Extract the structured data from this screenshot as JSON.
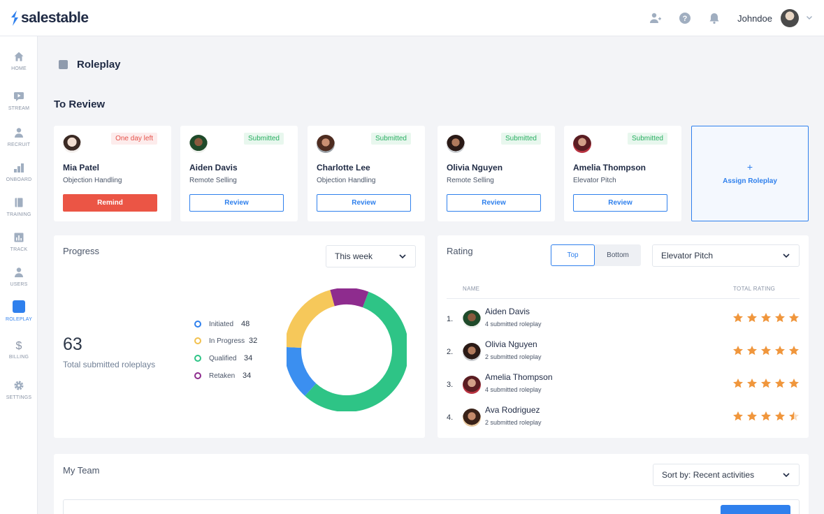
{
  "app": {
    "brand": "salestable"
  },
  "topbar": {
    "username": "Johndoe"
  },
  "sidebar": {
    "items": [
      {
        "label": "HOME",
        "icon": "home-icon"
      },
      {
        "label": "STREAM",
        "icon": "video-icon"
      },
      {
        "label": "RECRUIT",
        "icon": "recruit-icon"
      },
      {
        "label": "ONBOARD",
        "icon": "onboard-icon"
      },
      {
        "label": "TRAINING",
        "icon": "book-icon"
      },
      {
        "label": "TRACK",
        "icon": "chart-icon"
      },
      {
        "label": "USERS",
        "icon": "user-icon"
      },
      {
        "label": "ROLEPLAY",
        "icon": "roleplay-icon"
      },
      {
        "label": "BILLING",
        "icon": "dollar-icon"
      },
      {
        "label": "SETTINGS",
        "icon": "gear-icon"
      }
    ]
  },
  "page": {
    "title": "Roleplay"
  },
  "to_review": {
    "title": "To Review",
    "cards": [
      {
        "name": "Mia Patel",
        "topic": "Objection Handling",
        "status": "One day left",
        "button": "Remind"
      },
      {
        "name": "Aiden Davis",
        "topic": "Remote Selling",
        "status": "Submitted",
        "button": "Review"
      },
      {
        "name": "Charlotte Lee",
        "topic": "Objection Handling",
        "status": "Submitted",
        "button": "Review"
      },
      {
        "name": "Olivia Nguyen",
        "topic": "Remote Selling",
        "status": "Submitted",
        "button": "Review"
      },
      {
        "name": "Amelia Thompson",
        "topic": "Elevator Pitch",
        "status": "Submitted",
        "button": "Review"
      }
    ],
    "assign": {
      "plus": "+",
      "label": "Assign Roleplay"
    }
  },
  "progress": {
    "title": "Progress",
    "period": "This week",
    "total": "63",
    "total_label": "Total submitted roleplays",
    "legend": [
      {
        "name": "Initiated",
        "value": "48",
        "color": "#2f80ed"
      },
      {
        "name": "In Progress",
        "value": "32",
        "color": "#f2c14e"
      },
      {
        "name": "Qualified",
        "value": "34",
        "color": "#2ec486"
      },
      {
        "name": "Retaken",
        "value": "34",
        "color": "#8e2c8e"
      }
    ]
  },
  "chart_data": {
    "type": "pie",
    "categories": [
      "Qualified",
      "Initiated",
      "In Progress",
      "Retaken"
    ],
    "values": [
      56,
      14,
      20,
      10
    ],
    "colors": [
      "#2ec486",
      "#3b8ff0",
      "#f6c85a",
      "#8e2c8e"
    ]
  },
  "rating": {
    "title": "Rating",
    "toggle": {
      "top": "Top",
      "bottom": "Bottom"
    },
    "filter": "Elevator Pitch",
    "columns": {
      "name": "NAME",
      "total": "TOTAL RATING"
    },
    "rows": [
      {
        "rank": "1.",
        "name": "Aiden Davis",
        "sub": "4 submitted roleplay",
        "stars": 5
      },
      {
        "rank": "2.",
        "name": "Olivia Nguyen",
        "sub": "2 submitted roleplay",
        "stars": 5
      },
      {
        "rank": "3.",
        "name": "Amelia Thompson",
        "sub": "4 submitted roleplay",
        "stars": 5
      },
      {
        "rank": "4.",
        "name": "Ava Rodriguez",
        "sub": "2 submitted roleplay",
        "stars": 4.5
      }
    ],
    "star_color": "#f0963c"
  },
  "team": {
    "title": "My Team",
    "sort_prefix": "Sort by:",
    "sort_value": "Recent activities"
  }
}
